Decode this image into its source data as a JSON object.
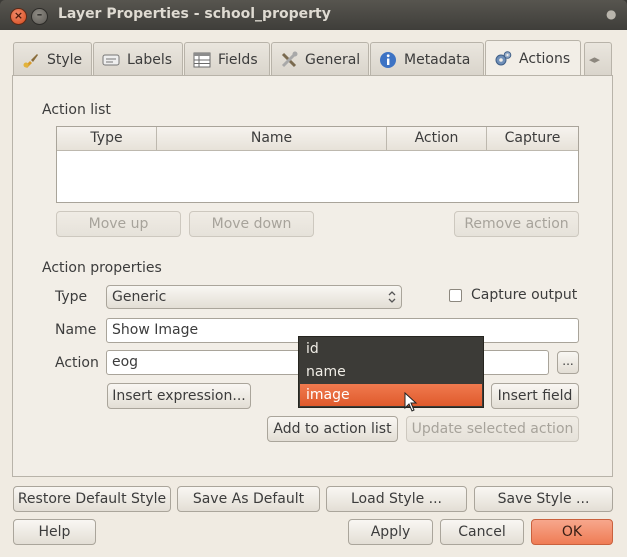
{
  "window": {
    "title": "Layer Properties - school_property",
    "close_glyph": "×",
    "min_glyph": "–",
    "menu_glyph": "●"
  },
  "tabs": [
    {
      "label": "Style",
      "icon": "paintbrush-icon"
    },
    {
      "label": "Labels",
      "icon": "labels-icon"
    },
    {
      "label": "Fields",
      "icon": "table-icon"
    },
    {
      "label": "General",
      "icon": "tools-icon"
    },
    {
      "label": "Metadata",
      "icon": "info-icon"
    },
    {
      "label": "Actions",
      "icon": "gears-icon",
      "active": true
    }
  ],
  "tab_scroll": {
    "left": "◂",
    "right": "▸"
  },
  "action_list": {
    "heading": "Action list",
    "columns": [
      "Type",
      "Name",
      "Action",
      "Capture"
    ],
    "rows": [],
    "buttons": {
      "move_up": "Move up",
      "move_down": "Move down",
      "remove": "Remove action"
    }
  },
  "action_properties": {
    "heading": "Action properties",
    "type_label": "Type",
    "type_value": "Generic",
    "capture_label": "Capture output",
    "capture_checked": false,
    "name_label": "Name",
    "name_value": "Show Image",
    "action_label": "Action",
    "action_value": "eog",
    "browse_label": "...",
    "insert_expression": "Insert expression...",
    "insert_field": "Insert field",
    "add_to_list": "Add to action list",
    "update_selected": "Update selected action",
    "field_popup": {
      "options": [
        "id",
        "name",
        "image"
      ],
      "selected": "image"
    }
  },
  "style_buttons": {
    "restore_default": "Restore Default Style",
    "save_default": "Save As Default",
    "load_style": "Load Style ...",
    "save_style": "Save Style ..."
  },
  "dialog_buttons": {
    "help": "Help",
    "apply": "Apply",
    "cancel": "Cancel",
    "ok": "OK"
  },
  "colors": {
    "accent": "#e9643a",
    "titlebar": "#3c3b37",
    "background": "#f0ebe2"
  }
}
